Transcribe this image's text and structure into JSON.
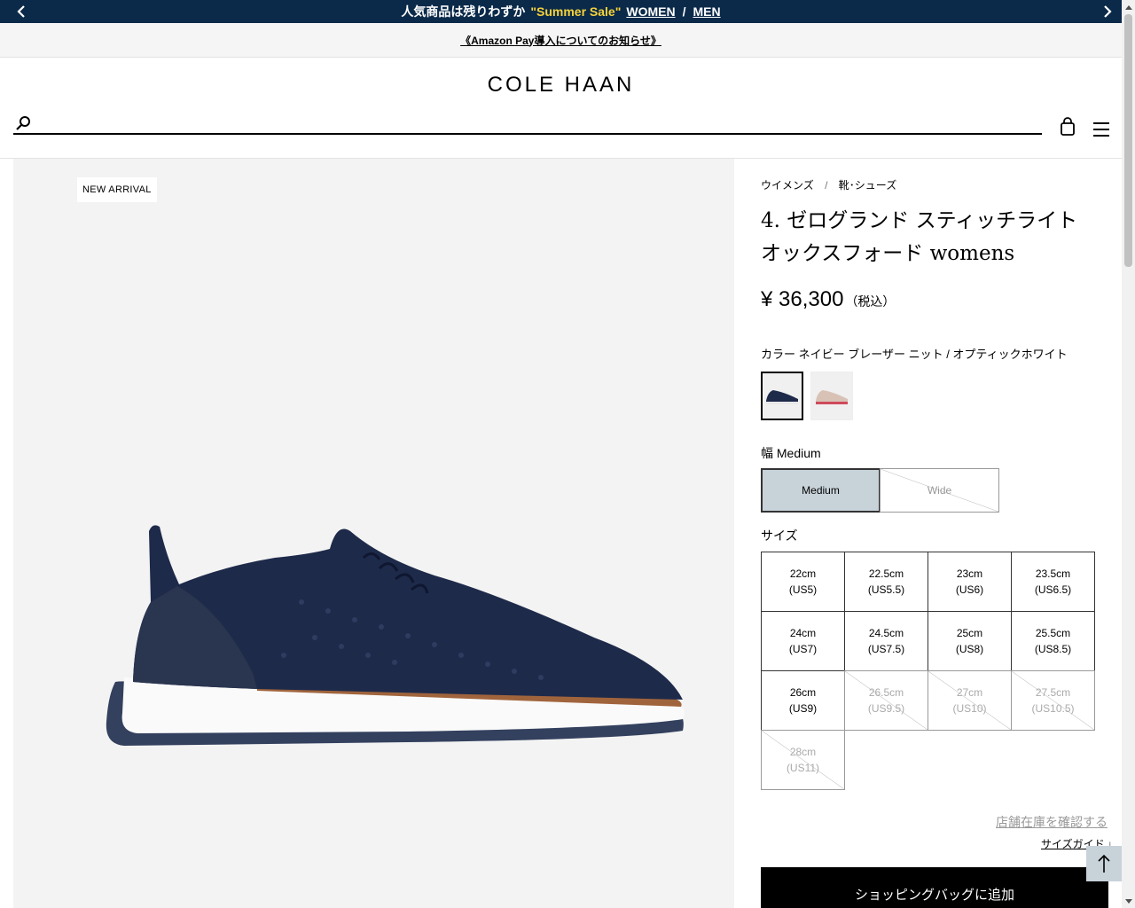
{
  "promo": {
    "text": "人気商品は残りわずか",
    "sale": "\"Summer Sale\"",
    "women": "WOMEN",
    "slash": "/",
    "men": "MEN"
  },
  "notice": {
    "text": "《Amazon Pay導入についてのお知らせ》"
  },
  "header": {
    "logo": "COLE HAAN",
    "search_placeholder": ""
  },
  "gallery": {
    "badge": "NEW ARRIVAL"
  },
  "product": {
    "breadcrumb": [
      "ウイメンズ",
      "/",
      "靴･シューズ"
    ],
    "title": "4. ゼログランド スティッチライト オックスフォード womens",
    "price": "¥ 36,300",
    "tax": "（税込）",
    "color_label": "カラー ネイビー ブレーザー ニット / オプティックホワイト",
    "width_label": "幅 Medium",
    "width_options": [
      "Medium",
      "Wide"
    ],
    "size_label": "サイズ",
    "sizes": [
      {
        "cm": "22cm",
        "us": "(US5)",
        "available": true
      },
      {
        "cm": "22.5cm",
        "us": "(US5.5)",
        "available": true
      },
      {
        "cm": "23cm",
        "us": "(US6)",
        "available": true
      },
      {
        "cm": "23.5cm",
        "us": "(US6.5)",
        "available": true
      },
      {
        "cm": "24cm",
        "us": "(US7)",
        "available": true
      },
      {
        "cm": "24.5cm",
        "us": "(US7.5)",
        "available": true
      },
      {
        "cm": "25cm",
        "us": "(US8)",
        "available": true
      },
      {
        "cm": "25.5cm",
        "us": "(US8.5)",
        "available": true
      },
      {
        "cm": "26cm",
        "us": "(US9)",
        "available": true
      },
      {
        "cm": "26.5cm",
        "us": "(US9.5)",
        "available": false
      },
      {
        "cm": "27cm",
        "us": "(US10)",
        "available": false
      },
      {
        "cm": "27.5cm",
        "us": "(US10.5)",
        "available": false
      },
      {
        "cm": "28cm",
        "us": "(US11)",
        "available": false
      }
    ],
    "store_link": "店舗在庫を確認する",
    "size_guide": "サイズガイド ↓",
    "add_to_bag": "ショッピングバッグに追加"
  },
  "colors": {
    "promo_bg": "#0b2a4a",
    "sale_accent": "#f7d33a",
    "selected_width_bg": "#c7d2d9",
    "navy_shoe": "#1e2a4a"
  }
}
